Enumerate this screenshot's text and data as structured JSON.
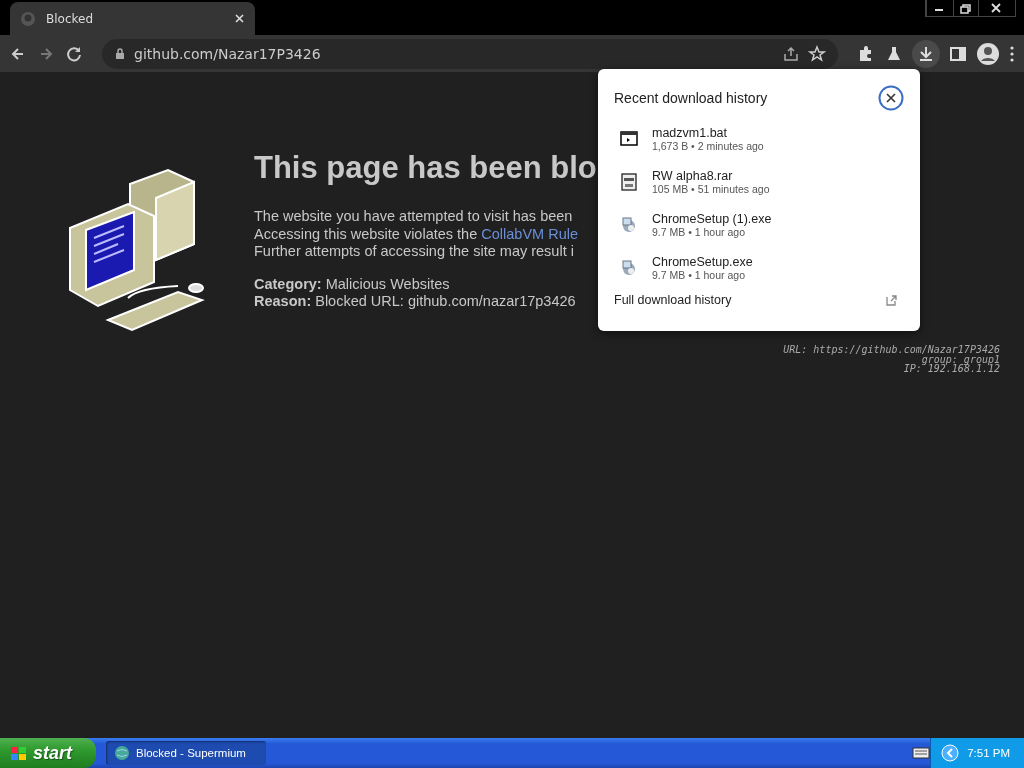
{
  "browser": {
    "tabs": [
      {
        "title": "Blocked",
        "selected": true
      }
    ],
    "address": "github.com/Nazar17P3426"
  },
  "page": {
    "heading": "This page has been blo",
    "lines": [
      {
        "text": "The website you have attempted to visit has been"
      },
      {
        "text": "Accessing this website violates the ",
        "link": "CollabVM Rule"
      },
      {
        "text": "Further attempts of accessing the site may result i"
      }
    ],
    "facts": [
      {
        "label": "Category:",
        "value": "Malicious Websites"
      },
      {
        "label": "Reason:",
        "value": "Blocked URL: github.com/nazar17p3426"
      }
    ],
    "info": [
      "URL: https://github.com/Nazar17P3426",
      "group: group1",
      "IP: 192.168.1.12"
    ]
  },
  "downloads": {
    "title": "Recent download history",
    "items": [
      {
        "name": "madzvm1.bat",
        "detail": "1,673 B • 2 minutes ago",
        "kind": "batch"
      },
      {
        "name": "RW  alpha8.rar",
        "detail": "105 MB • 51 minutes ago",
        "kind": "archive"
      },
      {
        "name": "ChromeSetup (1).exe",
        "detail": "9.7 MB • 1 hour ago",
        "kind": "installer"
      },
      {
        "name": "ChromeSetup.exe",
        "detail": "9.7 MB • 1 hour ago",
        "kind": "installer"
      }
    ],
    "footer": "Full download history"
  },
  "taskbar": {
    "start": "start",
    "tasks": [
      {
        "label": "Blocked - Supermium",
        "selected": true
      }
    ],
    "clock": "7:51 PM"
  }
}
